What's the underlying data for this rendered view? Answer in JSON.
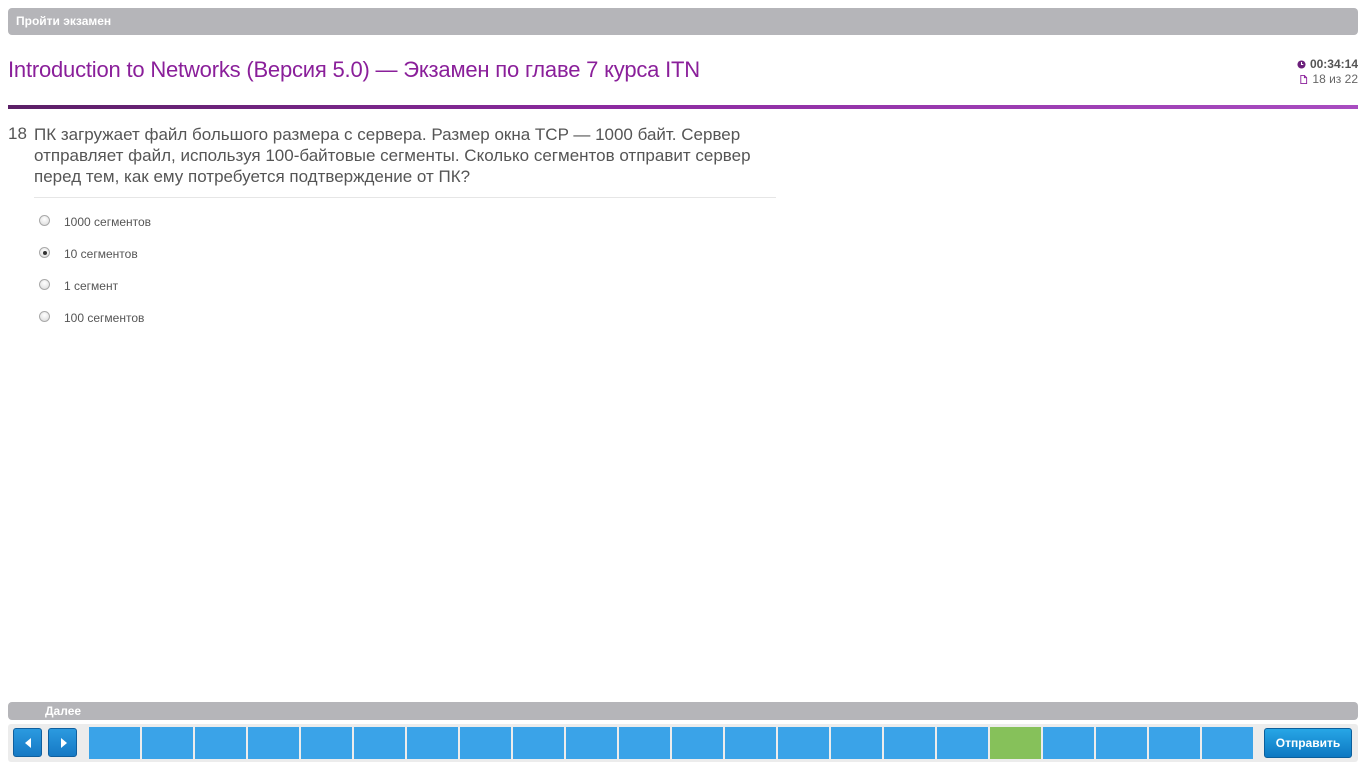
{
  "header": {
    "bar_label": "Пройти экзамен",
    "title": "Introduction to Networks (Версия 5.0) — Экзамен по главе 7 курса ITN",
    "timer": "00:34:14",
    "progress": "18 из 22",
    "timer_icon": "clock-icon",
    "progress_icon": "page-icon",
    "accent_color": "#8a1f9a"
  },
  "question": {
    "number": "18",
    "text": "ПК загружает файл большого размера с сервера. Размер окна TCP — 1000 байт. Сервер отправляет файл, используя 100-байтовые сегменты. Сколько сегментов отправит сервер перед тем, как ему потребуется подтверждение от ПК?",
    "answers": [
      {
        "label": "1000 сегментов",
        "selected": false
      },
      {
        "label": "10 сегментов",
        "selected": true
      },
      {
        "label": "1 сегмент",
        "selected": false
      },
      {
        "label": "100 сегментов",
        "selected": false
      }
    ]
  },
  "footer": {
    "bar_label": "Далее",
    "prev_icon": "arrow-left-icon",
    "next_icon": "arrow-right-icon",
    "question_count": 22,
    "current_question": 18,
    "cell_color": "#3aa3e8",
    "current_cell_color": "#86c15a",
    "submit_label": "Отправить"
  }
}
